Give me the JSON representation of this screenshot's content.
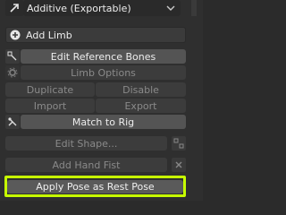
{
  "mode_dropdown": {
    "icon": "arrow-icon",
    "value": "Additive (Exportable)"
  },
  "add_limb": {
    "icon": "plus-circle-icon",
    "label": "Add Limb"
  },
  "buttons": {
    "edit_reference_bones": "Edit Reference Bones",
    "limb_options": "Limb Options",
    "duplicate": "Duplicate",
    "disable": "Disable",
    "import": "Import",
    "export": "Export",
    "match_to_rig": "Match to Rig",
    "edit_shape": "Edit Shape...",
    "add_hand_fist": "Add Hand Fist",
    "apply_pose_as_rest_pose": "Apply Pose as Rest Pose"
  },
  "colors": {
    "highlight": "#c7ff00"
  }
}
